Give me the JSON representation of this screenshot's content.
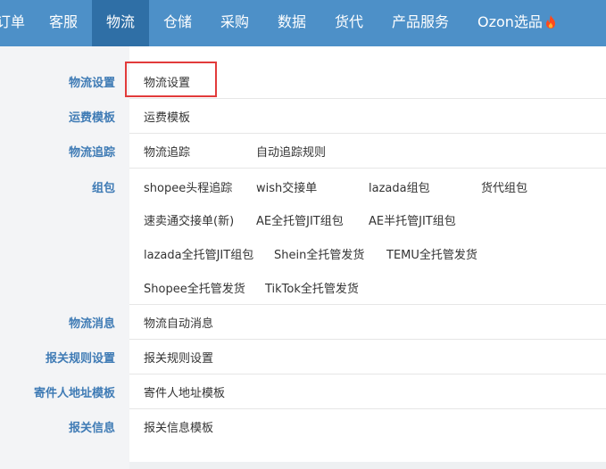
{
  "nav": {
    "items": [
      {
        "label": "订单"
      },
      {
        "label": "客服"
      },
      {
        "label": "物流"
      },
      {
        "label": "仓储"
      },
      {
        "label": "采购"
      },
      {
        "label": "数据"
      },
      {
        "label": "货代"
      },
      {
        "label": "产品服务"
      },
      {
        "label": "Ozon选品"
      }
    ],
    "active_index": 2
  },
  "menu": {
    "categories": [
      {
        "label": "物流设置",
        "links": [
          "物流设置"
        ]
      },
      {
        "label": "运费模板",
        "links": [
          "运费模板"
        ]
      },
      {
        "label": "物流追踪",
        "links": [
          "物流追踪",
          "自动追踪规则"
        ]
      },
      {
        "label": "组包",
        "links": [
          "shopee头程追踪",
          "wish交接单",
          "lazada组包",
          "货代组包",
          "速卖通交接单(新)",
          "AE全托管JIT组包",
          "AE半托管JIT组包",
          "lazada全托管JIT组包",
          "Shein全托管发货",
          "TEMU全托管发货",
          "Shopee全托管发货",
          "TikTok全托管发货"
        ]
      },
      {
        "label": "物流消息",
        "links": [
          "物流自动消息"
        ]
      },
      {
        "label": "报关规则设置",
        "links": [
          "报关规则设置"
        ]
      },
      {
        "label": "寄件人地址模板",
        "links": [
          "寄件人地址模板"
        ]
      },
      {
        "label": "报关信息",
        "links": [
          "报关信息模板"
        ]
      }
    ]
  },
  "colors": {
    "nav_bg": "#4d90c8",
    "nav_active_bg": "#2f6fa6",
    "category_text": "#3f7bb5",
    "highlight": "#e23b3b"
  }
}
